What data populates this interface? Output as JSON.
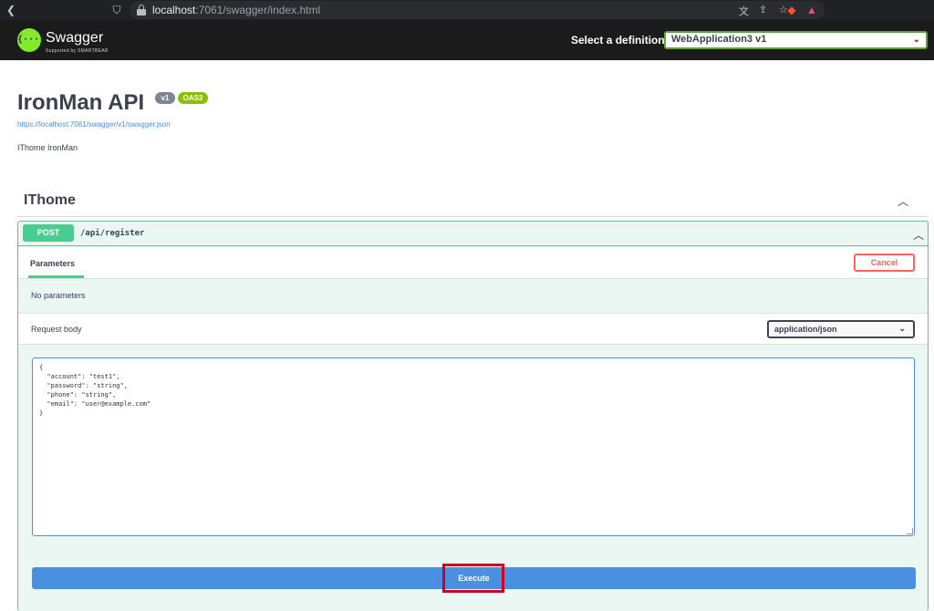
{
  "browser": {
    "url_host": "localhost",
    "url_rest": ":7061/swagger/index.html"
  },
  "topbar": {
    "logo_name": "Swagger",
    "logo_sub": "Supported by SMARTBEAR",
    "logo_glyph": "{···}",
    "definition_label": "Select a definition",
    "definition_value": "WebApplication3 v1"
  },
  "info": {
    "title": "IronMan API",
    "version_badge": "v1",
    "oas_badge": "OAS3",
    "spec_url": "https://localhost:7061/swagger/v1/swagger.json",
    "description": "IThome IronMan"
  },
  "tag": {
    "name": "IThome"
  },
  "operation": {
    "method": "POST",
    "path": "/api/register",
    "params_tab": "Parameters",
    "cancel_label": "Cancel",
    "no_params": "No parameters",
    "request_body_label": "Request body",
    "content_type": "application/json",
    "body_text": "{\n  \"account\": \"test1\",\n  \"password\": \"string\",\n  \"phone\": \"string\",\n  \"email\": \"user@example.com\"\n}",
    "execute_label": "Execute"
  },
  "colors": {
    "post_green": "#49cc90",
    "execute_blue": "#4990e2",
    "cancel_red": "#ff6060",
    "highlight_red": "#d0021b"
  }
}
